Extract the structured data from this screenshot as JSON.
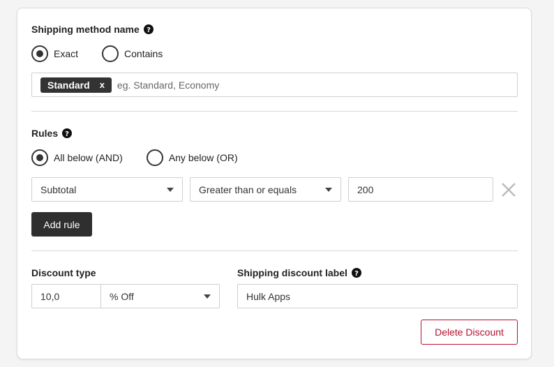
{
  "method": {
    "title": "Shipping method name",
    "options": [
      "Exact",
      "Contains"
    ],
    "selected": 0,
    "tag": "Standard",
    "tag_remove": "x",
    "placeholder": "eg. Standard, Economy"
  },
  "rules": {
    "title": "Rules",
    "options": [
      "All below (AND)",
      "Any below (OR)"
    ],
    "selected": 0,
    "field": "Subtotal",
    "operator": "Greater than or equals",
    "value": "200",
    "add_label": "Add rule"
  },
  "discount": {
    "type_title": "Discount type",
    "amount": "10,0",
    "unit": "% Off",
    "label_title": "Shipping discount label",
    "label_value": "Hulk Apps",
    "delete_label": "Delete Discount"
  },
  "colors": {
    "danger": "#b5122b",
    "dark": "#2f2f2f"
  }
}
